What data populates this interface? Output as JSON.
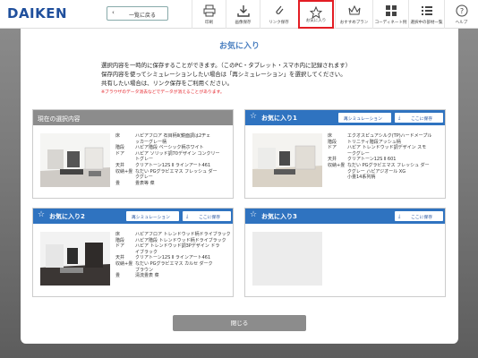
{
  "header": {
    "logo": "DAIKEN",
    "back_label": "一覧に戻る",
    "tools": [
      {
        "label": "印刷",
        "icon": "printer-icon"
      },
      {
        "label": "画像保存",
        "icon": "download-icon"
      },
      {
        "label": "リンク保存",
        "icon": "link-icon"
      },
      {
        "label": "お気に入り",
        "icon": "star-icon",
        "active": true
      },
      {
        "label": "おすすめプラン",
        "icon": "crown-icon"
      },
      {
        "label": "コーディネート例",
        "icon": "grid-icon"
      },
      {
        "label": "選択中の部材一覧",
        "icon": "list-icon"
      },
      {
        "label": "ヘルプ",
        "icon": "help-icon"
      }
    ]
  },
  "dialog": {
    "title": "お気に入り",
    "desc": [
      "選択内容を一時的に保存することができます。（このPC・タブレット・スマホ内に記録されます）",
      "保存内容を使ってシミュレーションしたい場合は「再シミュレーション」を選択してください。",
      "共有したい場合は、リンク保存をご利用ください。"
    ],
    "warning": "※ブラウザのデータ消去などでデータが消えることがあります。",
    "close_label": "閉じる",
    "resim_label": "再シミュレーション",
    "save_label": "ここに保存",
    "current": {
      "title": "現在の選択内容",
      "specs": [
        {
          "k": "床",
          "v": "ハピアフロア 石目柄Ⅱ(鏡面調は2ヂェ"
        },
        {
          "k": "",
          "v": "ッカーグレー柄"
        },
        {
          "k": "階段",
          "v": "ハピア階段 ベーシック柄ホワイト"
        },
        {
          "k": "ドア",
          "v": "ハピア ソリッド調70デザイン コンクリー"
        },
        {
          "k": "",
          "v": "トグレー"
        },
        {
          "k": "天井",
          "v": "クリアトーン12S Ⅱ ラインアート461"
        },
        {
          "k": "収納+畳",
          "v": "なだい PGグラビエマス フレッシュ ダー"
        },
        {
          "k": "",
          "v": "クグレー"
        },
        {
          "k": "畳",
          "v": "畳表等 菜"
        }
      ]
    },
    "fav1": {
      "title": "お気に入り1",
      "specs": [
        {
          "k": "床",
          "v": "エクオスピュアシルク(TP)ハードメープル"
        },
        {
          "k": "階段",
          "v": "トリニティ階段アッシュ柄"
        },
        {
          "k": "ドア",
          "v": "ハピア トレンドウッド調デザイン スモ"
        },
        {
          "k": "",
          "v": "ークグレー"
        },
        {
          "k": "天井",
          "v": "クリアトーン12S Ⅱ 601"
        },
        {
          "k": "収納+畳",
          "v": "なだい PGグラビエマス フレッシュ ダー"
        },
        {
          "k": "",
          "v": "クグレー ハピアジオール XG"
        },
        {
          "k": "",
          "v": "小畳14系列柄"
        }
      ]
    },
    "fav2": {
      "title": "お気に入り2",
      "specs": [
        {
          "k": "床",
          "v": "ハピアフロア トレンドウッド柄ドライブラック"
        },
        {
          "k": "階段",
          "v": "ハピア階段 トレンドウッド柄ドライブラック"
        },
        {
          "k": "ドア",
          "v": "ハピア トレンドウッド調3Pデザイン ドラ"
        },
        {
          "k": "",
          "v": "イブラック"
        },
        {
          "k": "天井",
          "v": "クリアトーン12S Ⅱ ラインアート461"
        },
        {
          "k": "収納+畳",
          "v": "なだい PGグラビエマス カルセ ダーク"
        },
        {
          "k": "",
          "v": "ブラウン"
        },
        {
          "k": "畳",
          "v": "清流畳表 菜"
        }
      ]
    },
    "fav3": {
      "title": "お気に入り3"
    }
  }
}
